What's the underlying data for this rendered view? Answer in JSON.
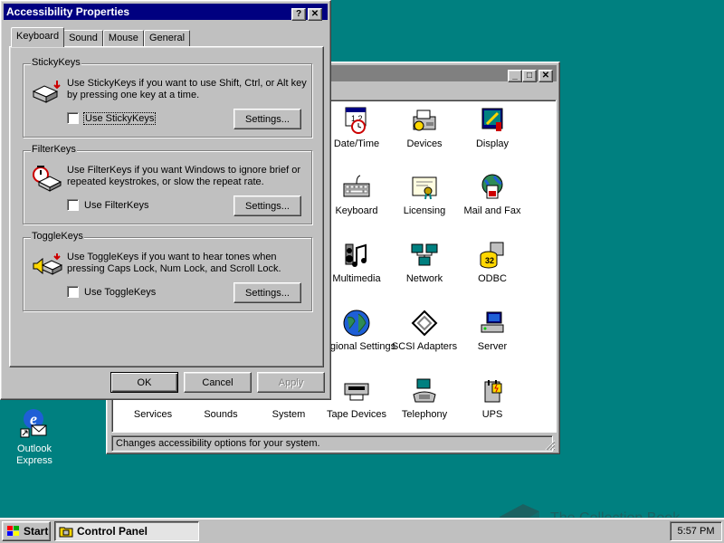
{
  "desktop": {
    "icon_label": "Outlook Express",
    "background_color": "#008080"
  },
  "control_panel": {
    "status_text": "Changes accessibility options for your system.",
    "items": [
      {
        "label": "Date/Time",
        "icon": "calendar-clock-icon"
      },
      {
        "label": "Devices",
        "icon": "devices-icon"
      },
      {
        "label": "Display",
        "icon": "display-icon"
      },
      {
        "label": "Keyboard",
        "icon": "keyboard-icon"
      },
      {
        "label": "Licensing",
        "icon": "licensing-icon"
      },
      {
        "label": "Mail and Fax",
        "icon": "mail-fax-icon"
      },
      {
        "label": "Multimedia",
        "icon": "multimedia-icon"
      },
      {
        "label": "Network",
        "icon": "network-icon"
      },
      {
        "label": "ODBC",
        "icon": "odbc-icon"
      },
      {
        "label": "Regional Settings",
        "icon": "globe-icon"
      },
      {
        "label": "SCSI Adapters",
        "icon": "scsi-icon"
      },
      {
        "label": "Server",
        "icon": "server-icon"
      },
      {
        "label": "Services",
        "icon": "services-icon"
      },
      {
        "label": "Sounds",
        "icon": "sounds-icon"
      },
      {
        "label": "System",
        "icon": "system-icon"
      },
      {
        "label": "Tape Devices",
        "icon": "tape-icon"
      },
      {
        "label": "Telephony",
        "icon": "telephone-icon"
      },
      {
        "label": "UPS",
        "icon": "ups-icon"
      }
    ]
  },
  "dialog": {
    "title": "Accessibility Properties",
    "help_btn": "?",
    "close_btn": "✕",
    "tabs": [
      "Keyboard",
      "Sound",
      "Mouse",
      "General"
    ],
    "sticky": {
      "group": "StickyKeys",
      "desc": "Use StickyKeys if you want to use Shift, Ctrl, or Alt key by pressing one key at a time.",
      "check": "Use StickyKeys",
      "button": "Settings..."
    },
    "filter": {
      "group": "FilterKeys",
      "desc": "Use FilterKeys if you want Windows to ignore brief or repeated keystrokes, or slow the repeat rate.",
      "check": "Use FilterKeys",
      "button": "Settings..."
    },
    "toggle": {
      "group": "ToggleKeys",
      "desc": "Use ToggleKeys if you want to hear tones when pressing Caps Lock, Num Lock, and Scroll Lock.",
      "check": "Use ToggleKeys",
      "button": "Settings..."
    },
    "ok": "OK",
    "cancel": "Cancel",
    "apply": "Apply"
  },
  "window_buttons": {
    "minimize": "_",
    "maximize": "□",
    "close": "✕"
  },
  "taskbar": {
    "start": "Start",
    "task": "Control Panel",
    "clock": "5:57 PM"
  },
  "watermark": "The Collection Book"
}
